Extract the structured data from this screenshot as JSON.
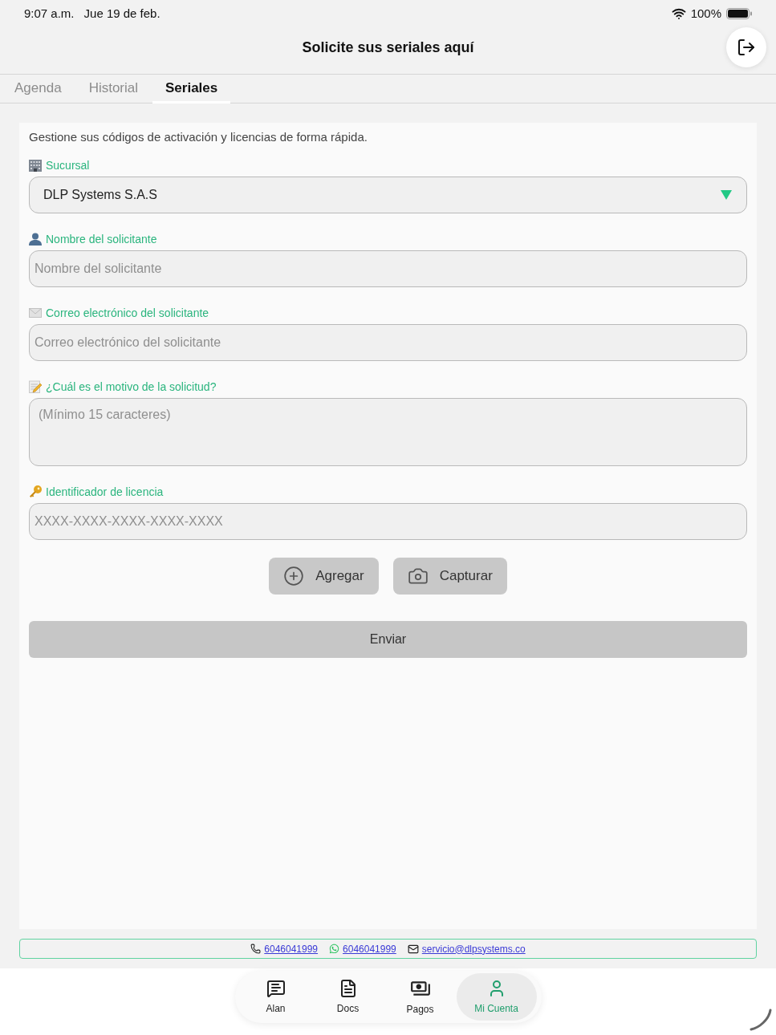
{
  "status_bar": {
    "time": "9:07 a.m.",
    "date": "Jue 19 de feb.",
    "battery": "100%"
  },
  "header": {
    "title": "Solicite sus seriales aquí"
  },
  "tabs": [
    {
      "label": "Agenda",
      "selected": false
    },
    {
      "label": "Historial",
      "selected": false
    },
    {
      "label": "Seriales",
      "selected": true
    }
  ],
  "form": {
    "description": "Gestione sus códigos de activación y licencias de forma rápida.",
    "fields": [
      {
        "kind": "select",
        "label": "Sucursal",
        "value": "DLP Systems S.A.S"
      },
      {
        "kind": "text",
        "label": "Nombre del solicitante",
        "placeholder": "Nombre del solicitante"
      },
      {
        "kind": "text",
        "label": "Correo electrónico del solicitante",
        "placeholder": "Correo electrónico del solicitante"
      },
      {
        "kind": "textarea",
        "label": "¿Cuál es el motivo de la solicitud?",
        "placeholder": "(Mínimo 15 caracteres)"
      },
      {
        "kind": "text",
        "label": "Identificador de licencia",
        "placeholder": "XXXX-XXXX-XXXX-XXXX-XXXX"
      }
    ],
    "actions": [
      {
        "label": "Agregar"
      },
      {
        "label": "Capturar"
      }
    ],
    "submit": {
      "label": "Enviar"
    }
  },
  "contact_bar": [
    {
      "kind": "phone",
      "label": "6046041999"
    },
    {
      "kind": "whatsapp",
      "label": "6046041999"
    },
    {
      "kind": "email",
      "label": "servicio@dlpsystems.co"
    }
  ],
  "bottom_nav": [
    {
      "label": "Alan",
      "selected": false
    },
    {
      "label": "Docs",
      "selected": false
    },
    {
      "label": "Pagos",
      "selected": false
    },
    {
      "label": "Mi Cuenta",
      "selected": true
    }
  ]
}
